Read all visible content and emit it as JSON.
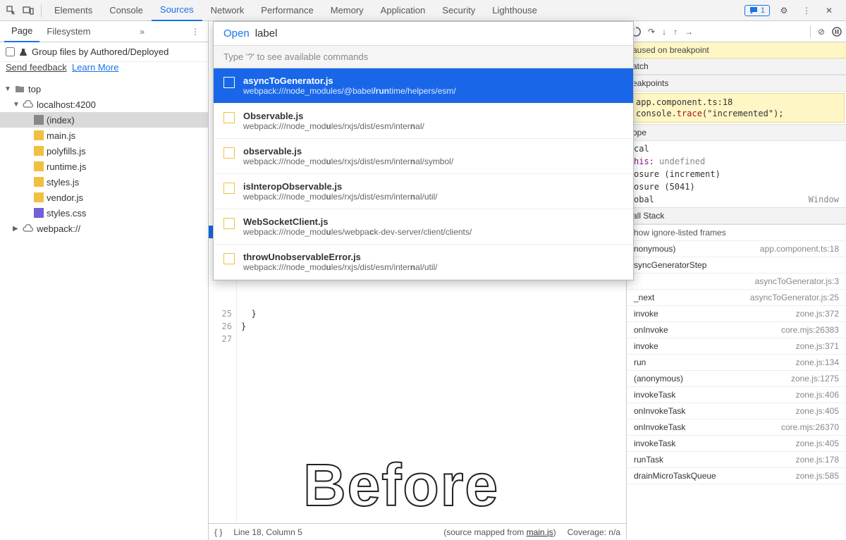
{
  "topTabs": [
    "Elements",
    "Console",
    "Sources",
    "Network",
    "Performance",
    "Memory",
    "Application",
    "Security",
    "Lighthouse"
  ],
  "topActive": 2,
  "issueCount": "1",
  "subTabs": [
    "Page",
    "Filesystem"
  ],
  "subActive": 0,
  "groupLabel": "Group files by Authored/Deployed",
  "feedback": "Send feedback",
  "learn": "Learn More",
  "tree": [
    {
      "depth": 0,
      "arrow": "▼",
      "icon": "folder",
      "label": "top"
    },
    {
      "depth": 1,
      "arrow": "▼",
      "icon": "cloud",
      "label": "localhost:4200"
    },
    {
      "depth": 2,
      "arrow": "",
      "icon": "doc",
      "label": "(index)",
      "sel": true
    },
    {
      "depth": 2,
      "arrow": "",
      "icon": "js",
      "label": "main.js"
    },
    {
      "depth": 2,
      "arrow": "",
      "icon": "js",
      "label": "polyfills.js"
    },
    {
      "depth": 2,
      "arrow": "",
      "icon": "js",
      "label": "runtime.js"
    },
    {
      "depth": 2,
      "arrow": "",
      "icon": "js",
      "label": "styles.js"
    },
    {
      "depth": 2,
      "arrow": "",
      "icon": "js",
      "label": "vendor.js"
    },
    {
      "depth": 2,
      "arrow": "",
      "icon": "css",
      "label": "styles.css"
    },
    {
      "depth": 1,
      "arrow": "▶",
      "icon": "cloud",
      "label": "webpack://"
    }
  ],
  "gutterLines": [
    "25",
    "26",
    "27"
  ],
  "codeLines": [
    "  }",
    "}",
    ""
  ],
  "status": {
    "cursor": "Line 18, Column 5",
    "mapped": "(source mapped from ",
    "mappedFile": "main.js",
    "mappedEnd": ")",
    "coverage": "Coverage: n/a"
  },
  "quickOpen": {
    "openLabel": "Open",
    "query": "label",
    "hint": "Type '?' to see available commands",
    "items": [
      {
        "title": "asyncToGenerator.js",
        "path": "webpack:///node_modules/@babel/runtime/helpers/esm/",
        "sel": true,
        "hlTitle": [
          12
        ],
        "hlPath": [
          30,
          31,
          32,
          33
        ]
      },
      {
        "title": "Observable.js",
        "path": "webpack:///node_modules/rxjs/dist/esm/internal/",
        "hlTitle": [
          6,
          7,
          8
        ],
        "hlPath": [
          19,
          43
        ]
      },
      {
        "title": "observable.js",
        "path": "webpack:///node_modules/rxjs/dist/esm/internal/symbol/",
        "hlTitle": [
          6,
          7,
          8
        ],
        "hlPath": [
          19,
          43
        ]
      },
      {
        "title": "isInteropObservable.js",
        "path": "webpack:///node_modules/rxjs/dist/esm/internal/util/",
        "hlTitle": [
          15,
          16,
          17
        ],
        "hlPath": [
          19,
          43
        ]
      },
      {
        "title": "WebSocketClient.js",
        "path": "webpack:///node_modules/webpack-dev-server/client/clients/",
        "hlTitle": [
          10,
          11
        ],
        "hlPath": [
          19,
          29
        ]
      },
      {
        "title": "throwUnobservableError.js",
        "path": "webpack:///node_modules/rxjs/dist/esm/internal/util/",
        "hlTitle": [
          14,
          15,
          16
        ],
        "hlPath": [
          19,
          43
        ]
      }
    ]
  },
  "pauseMsg": "aused on breakpoint",
  "sections": {
    "watch": "atch",
    "breakpoints": "eakpoints",
    "bpFile": "app.component.ts:18",
    "bpCode": "console.trace(\"incremented\");",
    "scope": "ope",
    "local": "cal",
    "thisK": "his:",
    "thisV": "undefined",
    "closure1": "osure (increment)",
    "closure2": "osure (5041)",
    "global": "obal",
    "globalV": "Window",
    "callstack": "all Stack",
    "ignore": "how ignore-listed frames"
  },
  "stack": [
    {
      "fn": "nonymous)",
      "loc": "app.component.ts:18"
    },
    {
      "fn": "syncGeneratorStep",
      "loc": ""
    },
    {
      "fn": "",
      "loc": "asyncToGenerator.js:3"
    },
    {
      "fn": "_next",
      "loc": "asyncToGenerator.js:25"
    },
    {
      "fn": "invoke",
      "loc": "zone.js:372"
    },
    {
      "fn": "onInvoke",
      "loc": "core.mjs:26383"
    },
    {
      "fn": "invoke",
      "loc": "zone.js:371"
    },
    {
      "fn": "run",
      "loc": "zone.js:134"
    },
    {
      "fn": "(anonymous)",
      "loc": "zone.js:1275"
    },
    {
      "fn": "invokeTask",
      "loc": "zone.js:406"
    },
    {
      "fn": "onInvokeTask",
      "loc": "zone.js:405"
    },
    {
      "fn": "onInvokeTask",
      "loc": "core.mjs:26370"
    },
    {
      "fn": "invokeTask",
      "loc": "zone.js:405"
    },
    {
      "fn": "runTask",
      "loc": "zone.js:178"
    },
    {
      "fn": "drainMicroTaskQueue",
      "loc": "zone.js:585"
    }
  ],
  "overlay": "Before"
}
